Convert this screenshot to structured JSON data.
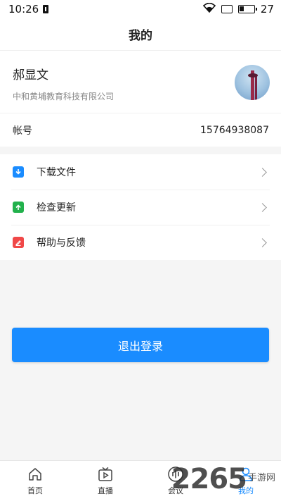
{
  "status": {
    "time": "10:26",
    "battery": "27"
  },
  "header": {
    "title": "我的"
  },
  "profile": {
    "name": "郝显文",
    "company": "中和黄埔教育科技有限公司"
  },
  "account": {
    "label": "帐号",
    "value": "15764938087"
  },
  "menu": {
    "items": [
      {
        "label": "下载文件",
        "icon": "download-folder-icon",
        "color": "#1a8cff"
      },
      {
        "label": "检查更新",
        "icon": "update-icon",
        "color": "#22b14c"
      },
      {
        "label": "帮助与反馈",
        "icon": "feedback-icon",
        "color": "#f04848"
      }
    ]
  },
  "logout": {
    "label": "退出登录"
  },
  "tabs": [
    {
      "label": "首页",
      "icon": "home-icon"
    },
    {
      "label": "直播",
      "icon": "live-tv-icon"
    },
    {
      "label": "会议",
      "icon": "meeting-icon"
    },
    {
      "label": "我的",
      "icon": "profile-icon",
      "active": true
    }
  ],
  "watermark": {
    "number": "2265",
    "text": "手游网"
  },
  "colors": {
    "accent": "#1a8cff"
  }
}
